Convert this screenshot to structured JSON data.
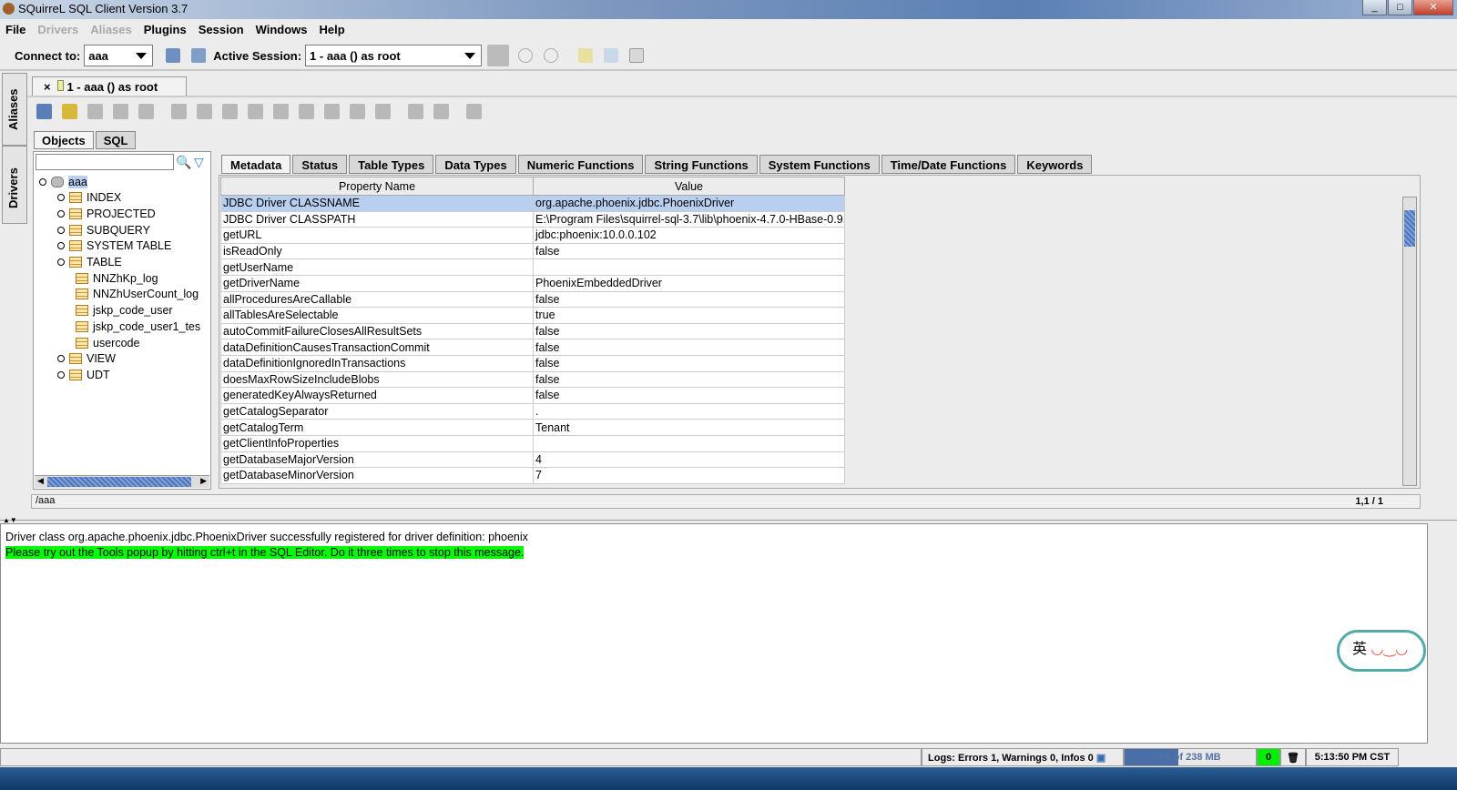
{
  "window": {
    "title": "SQuirreL SQL Client Version 3.7"
  },
  "menu": [
    {
      "label": "File",
      "enabled": true
    },
    {
      "label": "Drivers",
      "enabled": false
    },
    {
      "label": "Aliases",
      "enabled": false
    },
    {
      "label": "Plugins",
      "enabled": true
    },
    {
      "label": "Session",
      "enabled": true
    },
    {
      "label": "Windows",
      "enabled": true
    },
    {
      "label": "Help",
      "enabled": true
    }
  ],
  "toolbar": {
    "connect_label": "Connect to:",
    "connect_value": "aaa",
    "session_label": "Active Session:",
    "session_value": "1 - aaa () as root"
  },
  "side_tabs": [
    "Aliases",
    "Drivers"
  ],
  "session_tab": {
    "label": "1 - aaa () as root"
  },
  "object_tabs": [
    "Objects",
    "SQL"
  ],
  "tree": [
    {
      "label": "aaa",
      "level": 0,
      "icon": "database-icon",
      "selected": true
    },
    {
      "label": "INDEX",
      "level": 1,
      "icon": "table-folder-icon"
    },
    {
      "label": "PROJECTED",
      "level": 1,
      "icon": "table-folder-icon"
    },
    {
      "label": "SUBQUERY",
      "level": 1,
      "icon": "table-folder-icon"
    },
    {
      "label": "SYSTEM TABLE",
      "level": 1,
      "icon": "table-folder-icon"
    },
    {
      "label": "TABLE",
      "level": 1,
      "icon": "table-folder-icon"
    },
    {
      "label": "NNZhKp_log",
      "level": 2,
      "icon": "table-icon"
    },
    {
      "label": "NNZhUserCount_log",
      "level": 2,
      "icon": "table-icon"
    },
    {
      "label": "jskp_code_user",
      "level": 2,
      "icon": "table-icon"
    },
    {
      "label": "jskp_code_user1_tes",
      "level": 2,
      "icon": "table-icon"
    },
    {
      "label": "usercode",
      "level": 2,
      "icon": "table-icon"
    },
    {
      "label": "VIEW",
      "level": 1,
      "icon": "table-folder-icon"
    },
    {
      "label": "UDT",
      "level": 1,
      "icon": "udt-icon"
    }
  ],
  "main_tabs": [
    "Metadata",
    "Status",
    "Table Types",
    "Data Types",
    "Numeric Functions",
    "String Functions",
    "System Functions",
    "Time/Date Functions",
    "Keywords"
  ],
  "grid": {
    "columns": [
      "Property Name",
      "Value"
    ],
    "rows": [
      [
        "JDBC Driver CLASSNAME",
        "org.apache.phoenix.jdbc.PhoenixDriver"
      ],
      [
        "JDBC Driver CLASSPATH",
        "E:\\Program Files\\squirrel-sql-3.7\\lib\\phoenix-4.7.0-HBase-0.9..."
      ],
      [
        "getURL",
        "jdbc:phoenix:10.0.0.102"
      ],
      [
        "isReadOnly",
        "false"
      ],
      [
        "getUserName",
        ""
      ],
      [
        "getDriverName",
        "PhoenixEmbeddedDriver"
      ],
      [
        "allProceduresAreCallable",
        "false"
      ],
      [
        "allTablesAreSelectable",
        "true"
      ],
      [
        "autoCommitFailureClosesAllResultSets",
        "false"
      ],
      [
        "dataDefinitionCausesTransactionCommit",
        "false"
      ],
      [
        "dataDefinitionIgnoredInTransactions",
        "false"
      ],
      [
        "doesMaxRowSizeIncludeBlobs",
        "false"
      ],
      [
        "generatedKeyAlwaysReturned",
        "false"
      ],
      [
        "getCatalogSeparator",
        "."
      ],
      [
        "getCatalogTerm",
        "Tenant"
      ],
      [
        "getClientInfoProperties",
        ""
      ],
      [
        "getDatabaseMajorVersion",
        "4"
      ],
      [
        "getDatabaseMinorVersion",
        "7"
      ]
    ]
  },
  "path_bar": {
    "path": "/aaa",
    "position": "1,1 / 1"
  },
  "log": {
    "lines": [
      "Driver class org.apache.phoenix.jdbc.PhoenixDriver successfully registered for driver definition: phoenix"
    ],
    "highlight": "Please try out the Tools popup by hitting ctrl+t in the SQL Editor. Do it three times to stop this message."
  },
  "status": {
    "logs": "Logs: Errors 1, Warnings 0, Infos 0",
    "memory": "98 of 238 MB",
    "memory_used_fraction": 0.41,
    "counter": "0",
    "time": "5:13:50 PM CST"
  },
  "ime": {
    "label": "英"
  },
  "colors": {
    "highlight": "#00ff00",
    "selection": "#b8cff0",
    "memory_fill": "#4a6fa8"
  }
}
